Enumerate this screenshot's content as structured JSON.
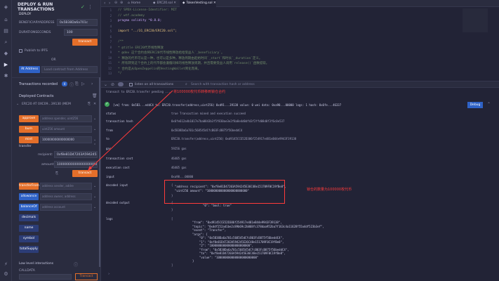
{
  "panel": {
    "title_line1": "DEPLOY & RUN",
    "title_line2": "TRANSACTIONS",
    "deploy_label": "DEPLOY",
    "beneficiary_label": "BENEFICIARYADDRESS",
    "beneficiary_value": "0x5B38Da6a701c",
    "duration_label": "DURATIONSECONDS",
    "duration_value": "100",
    "transact_label": "transact",
    "publish_ipfs": "Publish to IPFS",
    "or_label": "OR",
    "at_address": "At Address",
    "load_contract": "Load contract from Address",
    "tx_recorded_label": "Transactions recorded",
    "tx_recorded_count": "4",
    "deployed_contracts_label": "Deployed Contracts",
    "instance_label": "ERC20 AT 0XC09...39130 (MEM",
    "functions": [
      {
        "label": "approve",
        "placeholder": "address spender, uint256",
        "color": "#e46f2a"
      },
      {
        "label": "burn",
        "placeholder": "uint256 amount",
        "color": "#e46f2a"
      },
      {
        "label": "mint",
        "placeholder": "100000000000000000",
        "color": "#e46f2a"
      }
    ],
    "transfer_label": "transfer",
    "recipient_label": "recipient:",
    "recipient_value": "0xf8e81D47203A594245E",
    "amount_label": "amount:",
    "amount_value": "100000000000000000000",
    "transfer_transact": "transact",
    "functions2": [
      {
        "label": "transferFrom",
        "placeholder": "address sender, addre",
        "color": "#e46f2a"
      },
      {
        "label": "allowance",
        "placeholder": "address owner, address",
        "color": "#2f62c6"
      },
      {
        "label": "balanceOf",
        "placeholder": "address account",
        "color": "#2f62c6"
      }
    ],
    "views": [
      "decimals",
      "name",
      "symbol",
      "totalSupply"
    ],
    "low_level_label": "Low level interactions",
    "calldata_label": "CALLDATA",
    "low_level_transact": "Transact"
  },
  "tabs": [
    "Home",
    "ERC20.sol",
    "TokenVesting.sol"
  ],
  "editor": {
    "lines": [
      {
        "n": "1",
        "text": "// SPDX-License-Identifier: MIT",
        "cls": "c-comment"
      },
      {
        "n": "2",
        "text": "// wtf.academy",
        "cls": "c-comment"
      },
      {
        "n": "3",
        "text": "pragma solidity ^0.8.0;",
        "cls": "c-kw"
      },
      {
        "n": "4",
        "text": "",
        "cls": ""
      },
      {
        "n": "5",
        "text": "import \"../31_ERC20/ERC20.sol\";",
        "cls": "c-str"
      },
      {
        "n": "6",
        "text": "",
        "cls": ""
      },
      {
        "n": "7",
        "text": "/**",
        "cls": "c-comment"
      },
      {
        "n": "8",
        "text": " * @title ERC20代币线性释放",
        "cls": "c-comment"
      },
      {
        "n": "9",
        "text": " * @dev 这个合约会将ERC20代币线性释放给给受益人`_beneficiary`。",
        "cls": "c-comment"
      },
      {
        "n": "10",
        "text": " * 释放的代币可以是一种，也可以是多种。释放周期由起始时间`_start`和时长`_duration`定义。",
        "cls": "c-comment"
      },
      {
        "n": "11",
        "text": " * 所有转到这个合约上的代币都会遵循同样的线性释放周期，并且需要受益人调用`release()`函数提取。",
        "cls": "c-comment"
      },
      {
        "n": "12",
        "text": " * 合约是从OpenZeppelin的VestingWallet简化而来。",
        "cls": "c-comment"
      },
      {
        "n": "13",
        "text": " */",
        "cls": "c-comment"
      }
    ]
  },
  "terminal": {
    "listen_label": "listen on all transactions",
    "search_placeholder": "Search with transaction hash or address",
    "pending": "transact to ERC20.transfer pending ...",
    "annotation_top": "将100000枚代币转移到锁仓合约",
    "tx_summary": "[vm] from: 0x5B3...eddC4 to: ERC20.transfer(address,uint256) 0xd91...39138 value: 0 wei data: 0xa90...00000 logs: 1 hash: 0x6fe...46337",
    "debug_label": "Debug",
    "rows": [
      {
        "k": "status",
        "v": "true Transaction mined and execution succeed"
      },
      {
        "k": "transaction hash",
        "v": "0x6fe612a4b1017e7ba0843b3f5f830ae3e2f8a8e4d0dfd3f2ffd08d0f3f6c0e537"
      },
      {
        "k": "from",
        "v": "0x5B38Da6a701c568545dCfcB03FcB875f56beddC4"
      },
      {
        "k": "to",
        "v": "ERC20.transfer(address,uint256) 0xd9145CCE52D386f254917e481eB44e9943F39138"
      },
      {
        "k": "gas",
        "v": "59256 gas"
      },
      {
        "k": "transaction cost",
        "v": "46405 gas"
      },
      {
        "k": "execution cost",
        "v": "46405 gas"
      },
      {
        "k": "input",
        "v": "0xa90...00000"
      },
      {
        "k": "decoded input",
        "v": "{"
      },
      {
        "k": "decoded output",
        "v": "{"
      },
      {
        "k": "logs",
        "v": "["
      }
    ],
    "decoded_input_lines": [
      "\"address recipient\": \"0xf8e81D47203A594245E36C48e151709F0C19fBe8\",",
      "\"uint256 amount\": \"100000000000000000000000\""
    ],
    "annotation_mid": "锁仓的数量为100000枚代币",
    "decoded_output_line": "\"0\": \"bool: true\"",
    "log_lines": [
      "\"from\": \"0xd9145CCE52D386f254917e481eB44e9943F39138\",",
      "\"topic\": \"0xddf252ad1be2c89b69c2b068fc378daa952ba7f163c4a11628f55a4df523b3ef\",",
      "\"event\": \"Transfer\",",
      "\"args\": {",
      "\"0\": \"0x5B38Da6a701c568545dCfcB03FcB875f56beddC4\",",
      "\"1\": \"0xf8e81D47203A594245E36C48e151709F0C19fBe8\",",
      "\"2\": \"100000000000000000000000\",",
      "\"from\": \"0x5B38Da6a701c568545dCfcB03FcB875f56beddC4\",",
      "\"to\": \"0xf8e81D47203A594245E36C48e151709F0C19fBe8\",",
      "\"value\": \"100000000000000000000000\"",
      "}"
    ]
  }
}
